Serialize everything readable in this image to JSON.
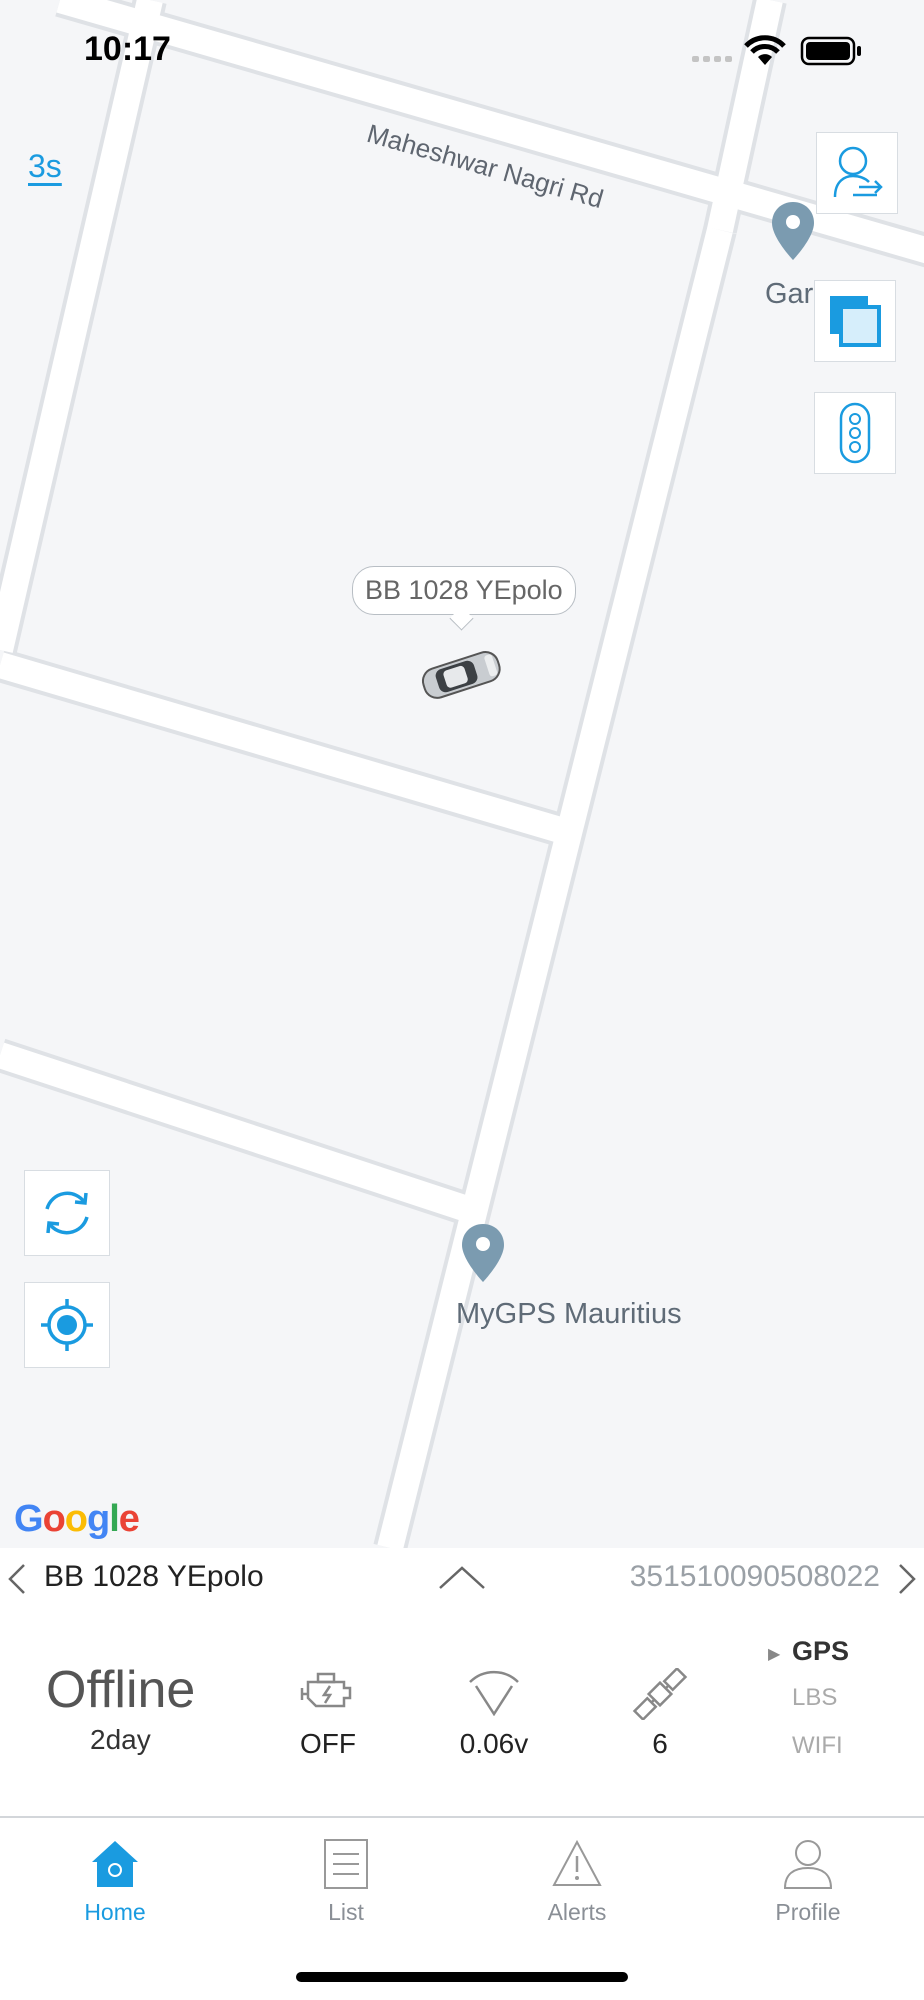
{
  "status_bar": {
    "time": "10:17"
  },
  "map": {
    "refresh_interval": "3s",
    "road_label": "Maheshwar Nagri Rd",
    "poi_top": "Gar    eo",
    "poi_bottom": "MyGPS Mauritius",
    "vehicle_label": "BB 1028 YEpolo",
    "google_logo": {
      "G": "G",
      "o1": "o",
      "o2": "o",
      "g": "g",
      "l": "l",
      "e": "e"
    },
    "buttons": [
      "switch-account-icon",
      "map-layers-icon",
      "traffic-light-icon",
      "refresh-icon",
      "locate-icon"
    ]
  },
  "device": {
    "name": "BB 1028 YEpolo",
    "imei": "351510090508022"
  },
  "info": {
    "status": "Offline",
    "duration": "2day",
    "engine": "OFF",
    "voltage": "0.06v",
    "satellites": "6",
    "location_modes": [
      "GPS",
      "LBS",
      "WIFI"
    ],
    "active_mode": "GPS"
  },
  "tabs": {
    "home": "Home",
    "list": "List",
    "alerts": "Alerts",
    "profile": "Profile"
  },
  "colors": {
    "accent": "#1a9be0",
    "pin": "#7b9bb0",
    "map_bg": "#f5f6f8"
  }
}
